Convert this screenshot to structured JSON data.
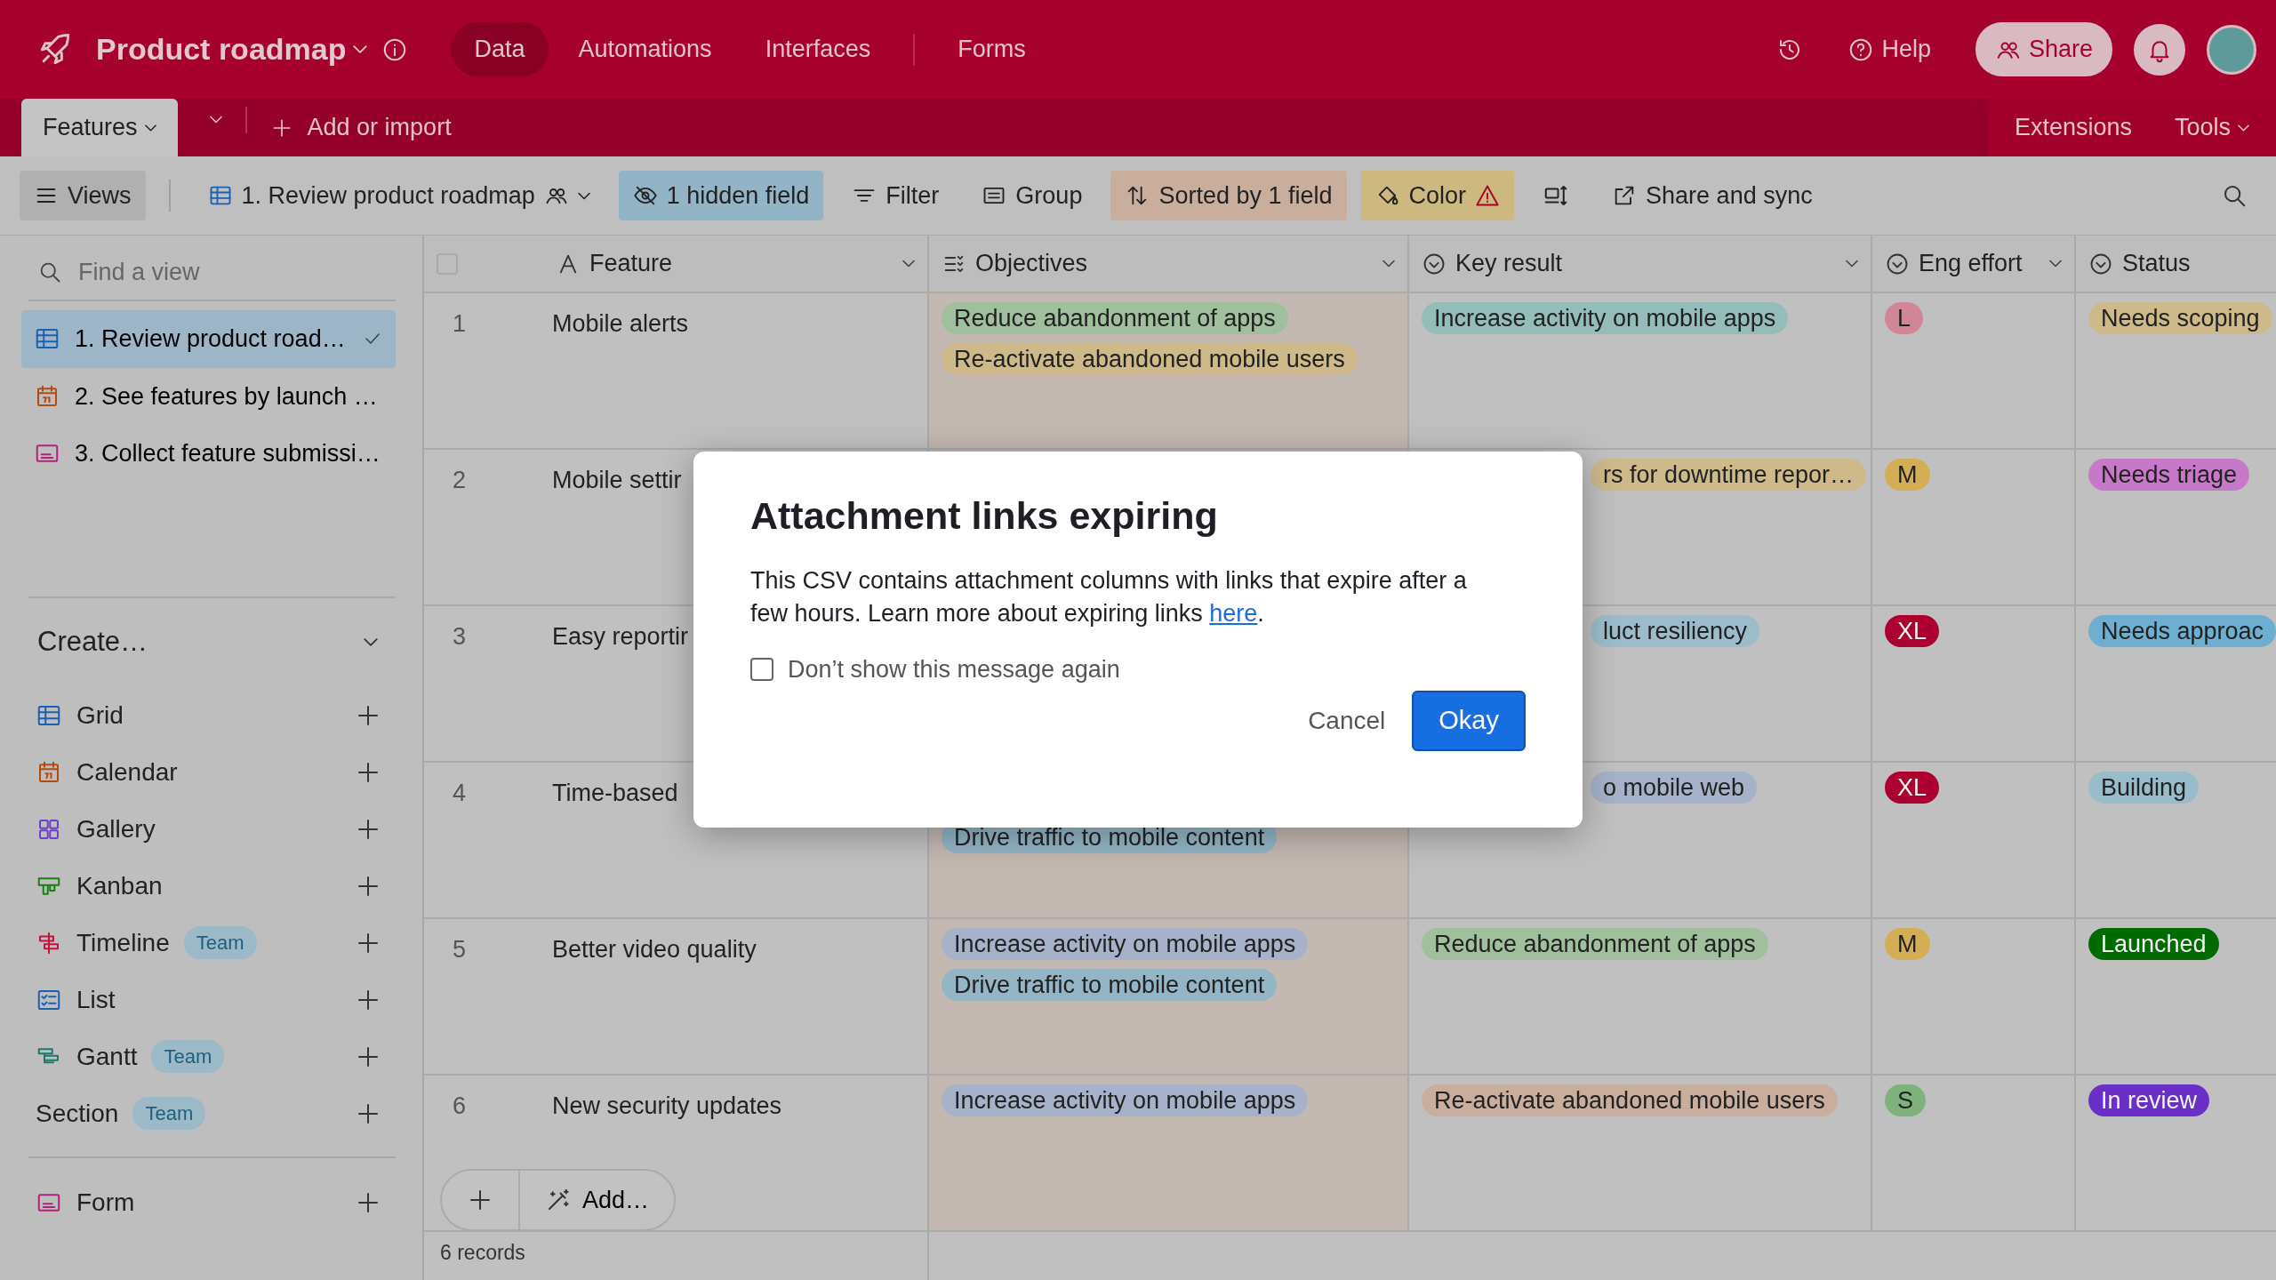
{
  "app": {
    "title": "Product roadmap",
    "nav": [
      {
        "label": "Data",
        "selected": true
      },
      {
        "label": "Automations",
        "selected": false
      },
      {
        "label": "Interfaces",
        "selected": false
      },
      {
        "label": "Forms",
        "selected": false
      }
    ],
    "help": "Help",
    "share": "Share"
  },
  "table_tabs": {
    "tabs": [
      {
        "label": "Features",
        "selected": true
      }
    ],
    "add": "Add or import",
    "right": [
      "Extensions",
      "Tools"
    ]
  },
  "toolbar": {
    "views": "Views",
    "view_name": "1. Review product roadmap",
    "hidden": "1 hidden field",
    "filter": "Filter",
    "group": "Group",
    "sort": "Sorted by 1 field",
    "color_button": "Color",
    "share_sync": "Share and sync"
  },
  "sidebar": {
    "search": {
      "placeholder": "Find a view"
    },
    "views": [
      {
        "kind": "grid",
        "label": "1. Review product road…",
        "selected": true
      },
      {
        "kind": "calendar",
        "label": "2. See features by launch …",
        "selected": false
      },
      {
        "kind": "form",
        "label": "3. Collect feature submissi…",
        "selected": false
      }
    ],
    "create_title": "Create…",
    "create": [
      {
        "kind": "grid",
        "label": "Grid"
      },
      {
        "kind": "calendar",
        "label": "Calendar"
      },
      {
        "kind": "gallery",
        "label": "Gallery"
      },
      {
        "kind": "kanban",
        "label": "Kanban"
      },
      {
        "kind": "timeline",
        "label": "Timeline",
        "badge": "Team"
      },
      {
        "kind": "list",
        "label": "List"
      },
      {
        "kind": "gantt",
        "label": "Gantt",
        "badge": "Team"
      },
      {
        "kind": "section",
        "label": "Section",
        "badge": "Team"
      }
    ],
    "form": {
      "kind": "form",
      "label": "Form"
    }
  },
  "table": {
    "select_all": {
      "checked": false
    },
    "columns": [
      {
        "kind": "text",
        "label": "Feature",
        "menu": true
      },
      {
        "kind": "multi",
        "label": "Objectives",
        "menu": true
      },
      {
        "kind": "single",
        "label": "Key result",
        "menu": true
      },
      {
        "kind": "single",
        "label": "Eng effort",
        "menu": true
      },
      {
        "kind": "single",
        "label": "Status",
        "menu": false
      }
    ],
    "rows": [
      {
        "number": "1",
        "feature": "Mobile alerts",
        "objectives": [
          {
            "label": "Reduce abandonment of apps",
            "color": "#9fbf9d"
          },
          {
            "label": "Re-activate abandoned mobile users",
            "color": "#cdb98a"
          }
        ],
        "key_result": {
          "label": "Increase activity on mobile apps",
          "color": "#94bdb9",
          "cut_left": false
        },
        "effort": {
          "label": "L",
          "color": "#d08696"
        },
        "status": {
          "label": "Needs scoping",
          "color": "#cdb98a"
        }
      },
      {
        "number": "2",
        "feature": "Mobile settir",
        "objectives": [],
        "key_result": {
          "label": "rs for downtime repor…",
          "color": "#cdb98a",
          "cut_left": true
        },
        "effort": {
          "label": "M",
          "color": "#d3ae55"
        },
        "status": {
          "label": "Needs triage",
          "color": "#c878c8"
        }
      },
      {
        "number": "3",
        "feature": "Easy reportir",
        "objectives": [],
        "key_result": {
          "label": "luct resiliency",
          "color": "#9dbccb",
          "cut_left": true
        },
        "effort": {
          "label": "XL",
          "color": "#ab002f"
        },
        "status": {
          "label": "Needs approac",
          "color": "#6eaed0"
        }
      },
      {
        "number": "4",
        "feature": "Time-based",
        "objectives": [
          {
            "label": "Drive traffic to mobile content",
            "color": "#93b5c6"
          }
        ],
        "objectives_cut_above": true,
        "key_result": {
          "label": "o mobile web",
          "color": "#a5b2c9",
          "cut_left": true
        },
        "effort": {
          "label": "XL",
          "color": "#ab002f"
        },
        "status": {
          "label": "Building",
          "color": "#99bccb"
        }
      },
      {
        "number": "5",
        "feature": "Better video quality",
        "objectives": [
          {
            "label": "Increase activity on mobile apps",
            "color": "#a5b2c9"
          },
          {
            "label": "Drive traffic to mobile content",
            "color": "#93b5c6"
          }
        ],
        "key_result": {
          "label": "Reduce abandonment of apps",
          "color": "#9fbf9d",
          "cut_left": false
        },
        "effort": {
          "label": "M",
          "color": "#d3ae55"
        },
        "status": {
          "label": "Launched",
          "color": "#006b00"
        }
      },
      {
        "number": "6",
        "feature": "New security updates",
        "objectives": [
          {
            "label": "Increase activity on mobile apps",
            "color": "#a5b2c9"
          }
        ],
        "key_result": {
          "label": "Re-activate abandoned mobile users",
          "color": "#c9ad9d",
          "cut_left": false
        },
        "effort": {
          "label": "S",
          "color": "#7fb17c"
        },
        "status": {
          "label": "In review",
          "color": "#6a2fc6"
        }
      }
    ],
    "add": "Add…",
    "records": "6 records"
  },
  "dialog": {
    "title": "Attachment links expiring",
    "body": "This CSV contains attachment columns with links that expire after a few hours. Learn more about expiring links ",
    "link": "here",
    "after": ".",
    "checkbox": {
      "label": "Don’t show this message again",
      "checked": false
    },
    "cancel": "Cancel",
    "ok": "Okay"
  }
}
